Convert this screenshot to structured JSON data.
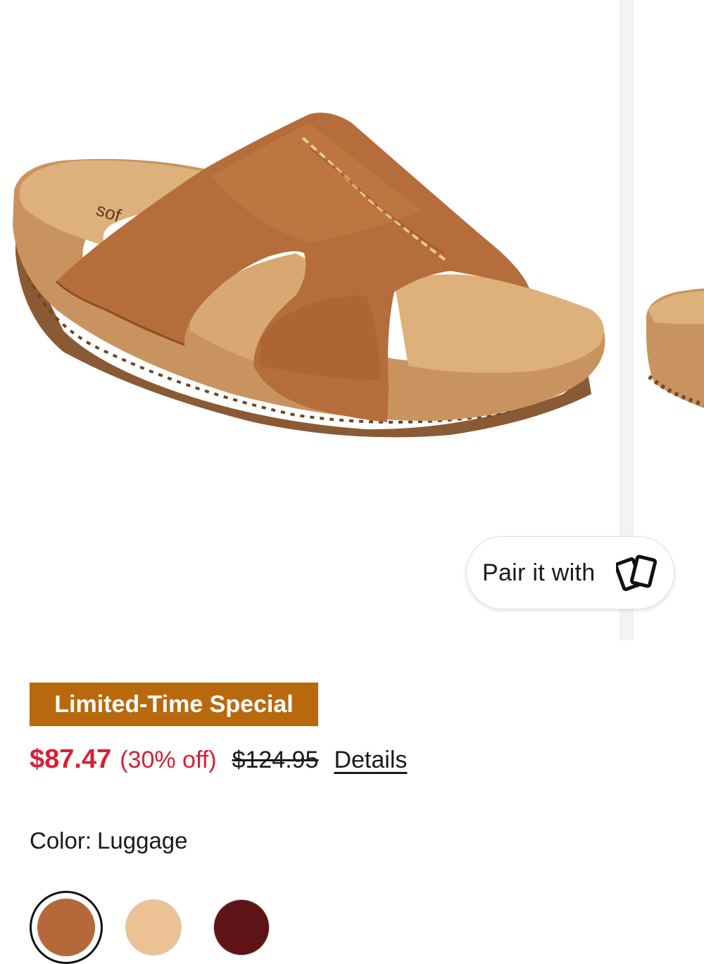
{
  "product": {
    "pair_button_label": "Pair it with",
    "pair_icon": "cards-icon",
    "badge": "Limited-Time Special",
    "sale_price": "$87.47",
    "discount": "(30% off)",
    "original_price": "$124.95",
    "details_link": "Details",
    "color_label": "Color:",
    "color_value": "Luggage"
  },
  "swatches": [
    {
      "name": "Luggage",
      "color": "#b5693a",
      "selected": true
    },
    {
      "name": "Beige",
      "color": "#ecc294",
      "selected": false
    },
    {
      "name": "Burgundy",
      "color": "#5e1416",
      "selected": false
    }
  ],
  "colors": {
    "badge_background": "#b8690e",
    "sale_red": "#d81f35",
    "leather": "#b56d3b",
    "cork": "#d5a46d"
  }
}
